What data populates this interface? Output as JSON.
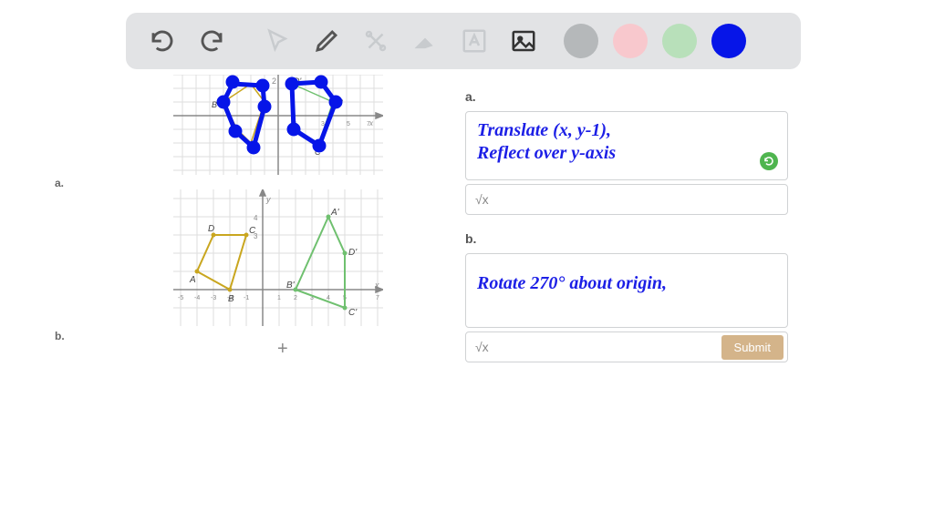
{
  "toolbar": {
    "icons": {
      "undo": "undo-icon",
      "redo": "redo-icon",
      "pointer": "pointer-icon",
      "pen": "pen-icon",
      "tools": "tools-icon",
      "eraser": "eraser-icon",
      "text": "text-icon",
      "image": "image-icon"
    },
    "colors": {
      "gray": "#b5b8ba",
      "pink": "#f8c8cd",
      "green": "#b8e0ba",
      "blue": "#0615e8"
    },
    "active_color": "blue"
  },
  "problem": {
    "label_a": "a.",
    "label_b": "b.",
    "plus_symbol": "+",
    "graph_a": {
      "x_range": [
        -7,
        7
      ],
      "y_range": [
        -4,
        4
      ],
      "preimage_label_B": "B",
      "image_labels": {
        "D": "D'",
        "B": "B'",
        "C": "C'"
      }
    },
    "graph_b": {
      "x_range": [
        -5,
        7
      ],
      "y_range": [
        -1,
        4
      ],
      "preimage": {
        "A": "A",
        "B": "B",
        "C": "C",
        "D": "D"
      },
      "image": {
        "A": "A'",
        "B": "B'",
        "C": "C'",
        "D": "D'"
      }
    }
  },
  "answers": {
    "a": {
      "label": "a.",
      "line1": "Translate (x, y-1),",
      "line2": "Reflect over y-axis",
      "math_toggle": "√x"
    },
    "b": {
      "label": "b.",
      "line1": "Rotate 270° about origin,",
      "math_toggle": "√x",
      "submit": "Submit"
    }
  }
}
